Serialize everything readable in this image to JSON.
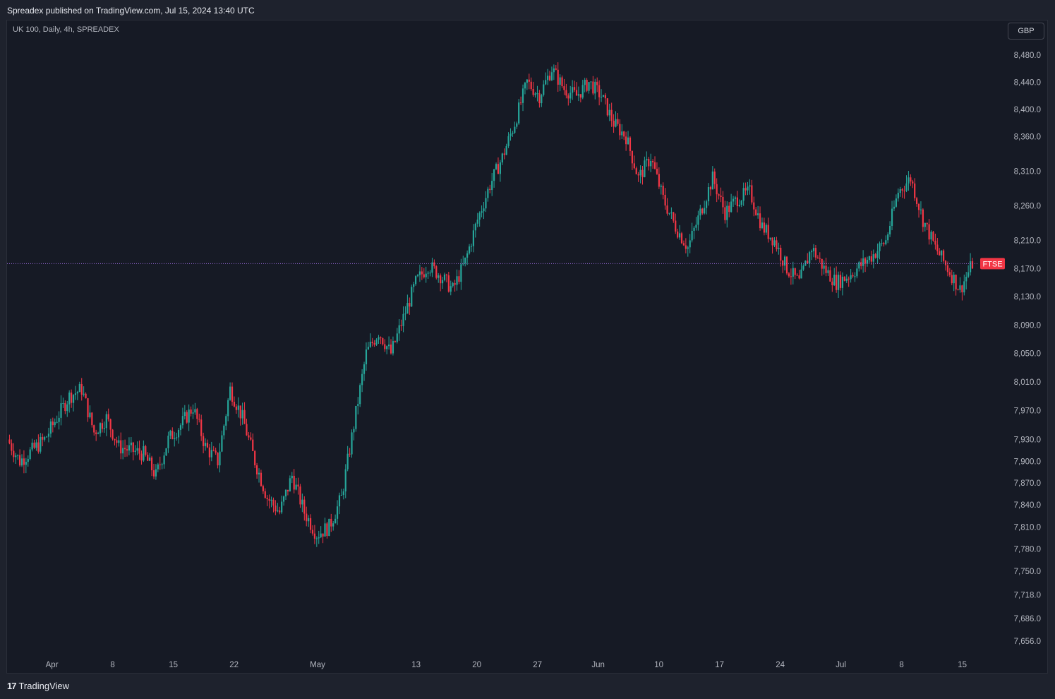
{
  "header": {
    "published": "Spreadex published on TradingView.com, Jul 15, 2024 13:40 UTC"
  },
  "symbol_line": "UK 100, Daily, 4h, SPREADEX",
  "currency_button": "GBP",
  "footer": {
    "brand": "TradingView"
  },
  "colors": {
    "up": "#26a69a",
    "down": "#f23645",
    "price_line": "#9c6ade",
    "background": "#161a25"
  },
  "chart_data": {
    "type": "candlestick",
    "instrument": "UK 100",
    "interval": "4h",
    "last_price_label": "FTSE",
    "last_price": 8177,
    "y_scale": "log",
    "ylim": [
      7630,
      8500
    ],
    "y_ticks": [
      "8,480.0",
      "8,440.0",
      "8,400.0",
      "8,360.0",
      "8,310.0",
      "8,260.0",
      "8,210.0",
      "8,170.0",
      "8,130.0",
      "8,090.0",
      "8,050.0",
      "8,010.0",
      "7,970.0",
      "7,930.0",
      "7,900.0",
      "7,870.0",
      "7,840.0",
      "7,810.0",
      "7,780.0",
      "7,750.0",
      "7,718.0",
      "7,686.0",
      "7,656.0"
    ],
    "y_tick_values": [
      8480,
      8440,
      8400,
      8360,
      8310,
      8260,
      8210,
      8170,
      8130,
      8090,
      8050,
      8010,
      7970,
      7930,
      7900,
      7870,
      7840,
      7810,
      7780,
      7750,
      7718,
      7686,
      7656
    ],
    "x_ticks": [
      "Apr",
      "8",
      "15",
      "22",
      "May",
      "13",
      "20",
      "27",
      "Jun",
      "10",
      "17",
      "24",
      "Jul",
      "8",
      "15"
    ],
    "close_path": [
      [
        "2024-03-27",
        7930
      ],
      [
        "2024-03-28",
        7900
      ],
      [
        "2024-04-01",
        7930
      ],
      [
        "2024-04-03",
        7990
      ],
      [
        "2024-04-04",
        8000
      ],
      [
        "2024-04-05",
        7940
      ],
      [
        "2024-04-08",
        7960
      ],
      [
        "2024-04-09",
        7920
      ],
      [
        "2024-04-11",
        7910
      ],
      [
        "2024-04-12",
        7880
      ],
      [
        "2024-04-15",
        7930
      ],
      [
        "2024-04-16",
        7950
      ],
      [
        "2024-04-17",
        7975
      ],
      [
        "2024-04-18",
        7920
      ],
      [
        "2024-04-19",
        7900
      ],
      [
        "2024-04-22",
        8000
      ],
      [
        "2024-04-23",
        7960
      ],
      [
        "2024-04-24",
        7900
      ],
      [
        "2024-04-25",
        7850
      ],
      [
        "2024-04-26",
        7830
      ],
      [
        "2024-04-29",
        7880
      ],
      [
        "2024-04-30",
        7830
      ],
      [
        "2024-05-01",
        7800
      ],
      [
        "2024-05-02",
        7810
      ],
      [
        "2024-05-03",
        7850
      ],
      [
        "2024-05-06",
        7950
      ],
      [
        "2024-05-07",
        8050
      ],
      [
        "2024-05-08",
        8080
      ],
      [
        "2024-05-09",
        8050
      ],
      [
        "2024-05-10",
        8100
      ],
      [
        "2024-05-13",
        8150
      ],
      [
        "2024-05-14",
        8175
      ],
      [
        "2024-05-15",
        8160
      ],
      [
        "2024-05-16",
        8140
      ],
      [
        "2024-05-17",
        8180
      ],
      [
        "2024-05-20",
        8240
      ],
      [
        "2024-05-21",
        8290
      ],
      [
        "2024-05-22",
        8330
      ],
      [
        "2024-05-23",
        8380
      ],
      [
        "2024-05-24",
        8440
      ],
      [
        "2024-05-27",
        8420
      ],
      [
        "2024-05-28",
        8460
      ],
      [
        "2024-05-29",
        8430
      ],
      [
        "2024-05-30",
        8420
      ],
      [
        "2024-05-31",
        8440
      ],
      [
        "2024-06-03",
        8420
      ],
      [
        "2024-06-04",
        8380
      ],
      [
        "2024-06-05",
        8360
      ],
      [
        "2024-06-06",
        8300
      ],
      [
        "2024-06-07",
        8330
      ],
      [
        "2024-06-10",
        8270
      ],
      [
        "2024-06-11",
        8230
      ],
      [
        "2024-06-12",
        8200
      ],
      [
        "2024-06-13",
        8250
      ],
      [
        "2024-06-14",
        8300
      ],
      [
        "2024-06-17",
        8250
      ],
      [
        "2024-06-18",
        8270
      ],
      [
        "2024-06-19",
        8280
      ],
      [
        "2024-06-20",
        8230
      ],
      [
        "2024-06-21",
        8210
      ],
      [
        "2024-06-24",
        8170
      ],
      [
        "2024-06-25",
        8150
      ],
      [
        "2024-06-26",
        8200
      ],
      [
        "2024-06-27",
        8170
      ],
      [
        "2024-06-28",
        8150
      ],
      [
        "2024-07-01",
        8160
      ],
      [
        "2024-07-02",
        8175
      ],
      [
        "2024-07-03",
        8190
      ],
      [
        "2024-07-04",
        8210
      ],
      [
        "2024-07-05",
        8280
      ],
      [
        "2024-07-08",
        8300
      ],
      [
        "2024-07-09",
        8240
      ],
      [
        "2024-07-10",
        8200
      ],
      [
        "2024-07-11",
        8170
      ],
      [
        "2024-07-12",
        8140
      ],
      [
        "2024-07-15",
        8177
      ]
    ]
  }
}
